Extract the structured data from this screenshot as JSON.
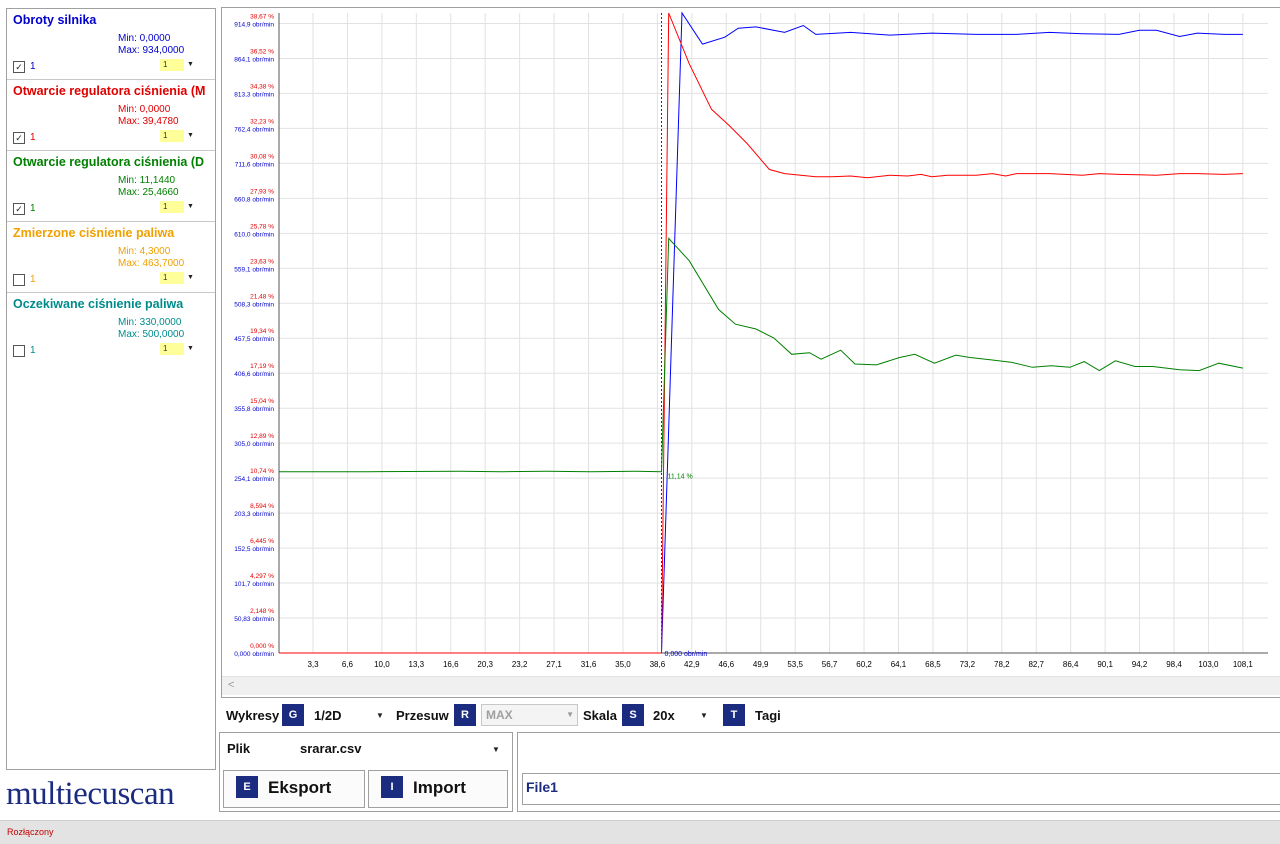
{
  "channels": [
    {
      "title": "Obroty silnika",
      "min": "Min: 0,0000",
      "max": "Max: 934,0000",
      "color": "#0000cc",
      "checked": true,
      "check_mark": "✓",
      "num": "1",
      "scale": "1"
    },
    {
      "title": "Otwarcie regulatora ciśnienia (M",
      "min": "Min: 0,0000",
      "max": "Max: 39,4780",
      "color": "#e00000",
      "checked": true,
      "check_mark": "✓",
      "num": "1",
      "scale": "1"
    },
    {
      "title": "Otwarcie regulatora ciśnienia (D",
      "min": "Min: 11,1440",
      "max": "Max: 25,4660",
      "color": "#008000",
      "checked": true,
      "check_mark": "✓",
      "num": "1",
      "scale": "1"
    },
    {
      "title": "Zmierzone ciśnienie paliwa",
      "min": "Min: 4,3000",
      "max": "Max: 463,7000",
      "color": "#f0a000",
      "checked": false,
      "check_mark": "",
      "num": "1",
      "scale": "1"
    },
    {
      "title": "Oczekiwane ciśnienie paliwa",
      "min": "Min: 330,0000",
      "max": "Max: 500,0000",
      "color": "#008b8b",
      "checked": false,
      "check_mark": "",
      "num": "1",
      "scale": "1"
    }
  ],
  "controls": {
    "wykresy_label": "Wykresy",
    "wykresy_key": "G",
    "wykresy_value": "1/2D",
    "przesuw_label": "Przesuw",
    "przesuw_key": "R",
    "przesuw_value": "MAX",
    "skala_label": "Skala",
    "skala_key": "S",
    "skala_value": "20x",
    "tagi_key": "T",
    "tagi_label": "Tagi"
  },
  "file": {
    "label": "Plik",
    "name": "srarar.csv",
    "export_key": "E",
    "export_label": "Eksport",
    "import_key": "I",
    "import_label": "Import",
    "tab_label": "File1"
  },
  "logo": "multiecuscan",
  "status": "Rozłączony",
  "chart_data": {
    "type": "line",
    "x_ticks": [
      "3,3",
      "6,6",
      "10,0",
      "13,3",
      "16,6",
      "20,3",
      "23,2",
      "27,1",
      "31,6",
      "35,0",
      "38,6",
      "42,9",
      "46,6",
      "49,9",
      "53,5",
      "56,7",
      "60,2",
      "64,1",
      "68,5",
      "73,2",
      "78,2",
      "82,7",
      "86,4",
      "90,1",
      "94,2",
      "98,4",
      "103,0",
      "108,1"
    ],
    "y_ticks_pct": [
      "38,67 %",
      "36,52 %",
      "34,38 %",
      "32,23 %",
      "30,08 %",
      "27,93 %",
      "25,78 %",
      "23,63 %",
      "21,48 %",
      "19,34 %",
      "17,19 %",
      "15,04 %",
      "12,89 %",
      "10,74 %",
      "8,594 %",
      "6,445 %",
      "4,297 %",
      "2,148 %",
      "0,000 %"
    ],
    "y_ticks_rpm": [
      "914,9 obr/min",
      "864,1 obr/min",
      "813,3 obr/min",
      "762,4 obr/min",
      "711,6 obr/min",
      "660,8 obr/min",
      "610,0 obr/min",
      "559,1 obr/min",
      "508,3 obr/min",
      "457,5 obr/min",
      "406,6 obr/min",
      "355,8 obr/min",
      "305,0 obr/min",
      "254,1 obr/min",
      "203,3 obr/min",
      "152,5 obr/min",
      "101,7 obr/min",
      "50,83 obr/min",
      "0,000 obr/min"
    ],
    "cursor_x": 42.9,
    "cursor_labels": {
      "rpm": "0,000 obr/min",
      "green": "11,14 %"
    },
    "series": [
      {
        "color": "#0000ff",
        "axis": "rpm",
        "points": [
          [
            0,
            0
          ],
          [
            42.9,
            0
          ],
          [
            45.2,
            934
          ],
          [
            47.5,
            885
          ],
          [
            50,
            895
          ],
          [
            51.5,
            908
          ],
          [
            53.5,
            910
          ],
          [
            56.7,
            902
          ],
          [
            58.8,
            912
          ],
          [
            60.2,
            899
          ],
          [
            64.1,
            902
          ],
          [
            68.5,
            898
          ],
          [
            73.2,
            901
          ],
          [
            78.2,
            899
          ],
          [
            82.7,
            899
          ],
          [
            86.4,
            902
          ],
          [
            90.1,
            900
          ],
          [
            94.2,
            899
          ],
          [
            96.5,
            905
          ],
          [
            98.4,
            905
          ],
          [
            101,
            896
          ],
          [
            103,
            901
          ],
          [
            106,
            899
          ],
          [
            108.1,
            899
          ]
        ]
      },
      {
        "color": "#ff0000",
        "axis": "pct",
        "points": [
          [
            0,
            0
          ],
          [
            42.9,
            0
          ],
          [
            43.7,
            39.478
          ],
          [
            46,
            36.2
          ],
          [
            48.5,
            33.4
          ],
          [
            50.5,
            32.4
          ],
          [
            52.5,
            31.3
          ],
          [
            55,
            29.7
          ],
          [
            56.7,
            29.45
          ],
          [
            60.2,
            29.25
          ],
          [
            62,
            29.25
          ],
          [
            64.1,
            29.3
          ],
          [
            66,
            29.2
          ],
          [
            68.5,
            29.35
          ],
          [
            70.5,
            29.3
          ],
          [
            72,
            29.4
          ],
          [
            73.2,
            29.25
          ],
          [
            75,
            29.35
          ],
          [
            78.2,
            29.35
          ],
          [
            80,
            29.45
          ],
          [
            81.5,
            29.3
          ],
          [
            82.7,
            29.45
          ],
          [
            86.4,
            29.45
          ],
          [
            90.1,
            29.35
          ],
          [
            92,
            29.45
          ],
          [
            94.2,
            29.4
          ],
          [
            98.4,
            29.35
          ],
          [
            101,
            29.45
          ],
          [
            103,
            29.45
          ],
          [
            106,
            29.4
          ],
          [
            108.1,
            29.45
          ]
        ]
      },
      {
        "color": "#008000",
        "axis": "pct",
        "points": [
          [
            0,
            11.14
          ],
          [
            10,
            11.14
          ],
          [
            20.3,
            11.17
          ],
          [
            25,
            11.14
          ],
          [
            30,
            11.16
          ],
          [
            35,
            11.14
          ],
          [
            40,
            11.16
          ],
          [
            42.9,
            11.14
          ],
          [
            43.7,
            25.466
          ],
          [
            46,
            24.1
          ],
          [
            49.3,
            21.1
          ],
          [
            51.2,
            20.2
          ],
          [
            53.5,
            19.9
          ],
          [
            55.5,
            19.35
          ],
          [
            57.5,
            18.35
          ],
          [
            59.5,
            18.45
          ],
          [
            60.8,
            18.05
          ],
          [
            63,
            18.6
          ],
          [
            64.6,
            17.75
          ],
          [
            67,
            17.7
          ],
          [
            69.6,
            18.15
          ],
          [
            71.3,
            18.35
          ],
          [
            73.5,
            17.8
          ],
          [
            75.9,
            18.3
          ],
          [
            77.5,
            18.15
          ],
          [
            80,
            18.0
          ],
          [
            82.2,
            17.85
          ],
          [
            84.5,
            17.55
          ],
          [
            86.6,
            17.65
          ],
          [
            88.7,
            17.55
          ],
          [
            90.3,
            17.9
          ],
          [
            92,
            17.35
          ],
          [
            93.8,
            17.95
          ],
          [
            96,
            17.6
          ],
          [
            98,
            17.6
          ],
          [
            101,
            17.4
          ],
          [
            103.2,
            17.35
          ],
          [
            105.4,
            17.8
          ],
          [
            108.1,
            17.5
          ]
        ]
      }
    ],
    "x_range": [
      0,
      108.1
    ],
    "y_range_pct": [
      0,
      38.67
    ],
    "y_range_rpm": [
      0,
      914.9
    ],
    "grid": true
  }
}
